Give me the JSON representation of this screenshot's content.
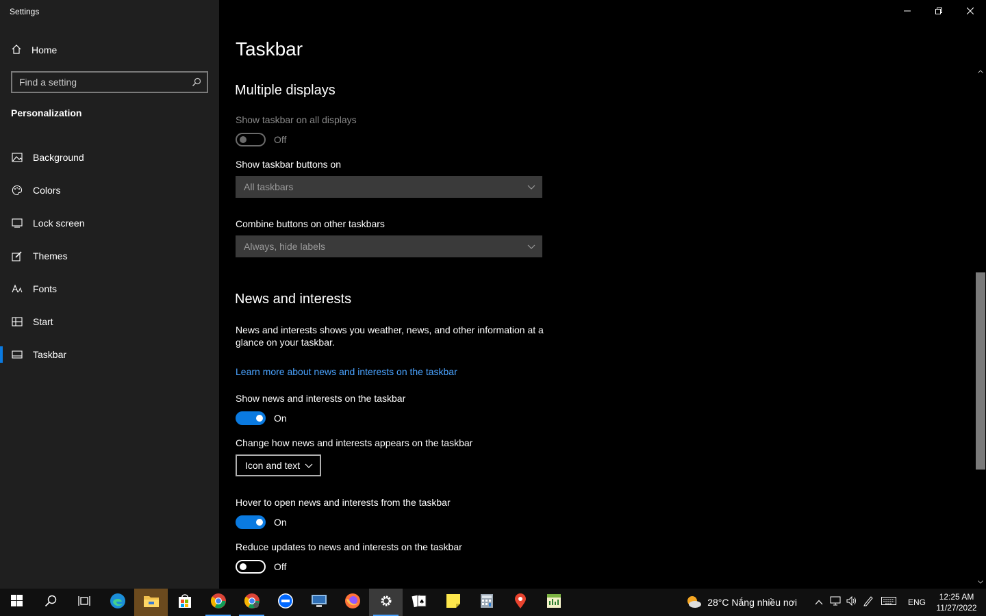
{
  "window": {
    "title": "Settings"
  },
  "sidebar": {
    "home_label": "Home",
    "search_placeholder": "Find a setting",
    "section": "Personalization",
    "items": [
      {
        "label": "Background",
        "icon": "picture-icon"
      },
      {
        "label": "Colors",
        "icon": "palette-icon"
      },
      {
        "label": "Lock screen",
        "icon": "lock-screen-icon"
      },
      {
        "label": "Themes",
        "icon": "brush-icon"
      },
      {
        "label": "Fonts",
        "icon": "font-icon"
      },
      {
        "label": "Start",
        "icon": "start-icon"
      },
      {
        "label": "Taskbar",
        "icon": "taskbar-icon",
        "active": true
      }
    ]
  },
  "main": {
    "title": "Taskbar",
    "multiple_displays": {
      "heading": "Multiple displays",
      "show_all_label": "Show taskbar on all displays",
      "show_all_state": "Off",
      "buttons_on_label": "Show taskbar buttons on",
      "buttons_on_value": "All taskbars",
      "combine_label": "Combine buttons on other taskbars",
      "combine_value": "Always, hide labels"
    },
    "news": {
      "heading": "News and interests",
      "description": "News and interests shows you weather, news, and other information at a glance on your taskbar.",
      "link": "Learn more about news and interests on the taskbar",
      "show_label": "Show news and interests on the taskbar",
      "show_state": "On",
      "appearance_label": "Change how news and interests appears on the taskbar",
      "appearance_value": "Icon and text",
      "hover_label": "Hover to open news and interests from the taskbar",
      "hover_state": "On",
      "reduce_label": "Reduce updates to news and interests on the taskbar",
      "reduce_state": "Off"
    }
  },
  "taskbar": {
    "weather": "28°C  Nắng nhiều nơi",
    "language": "ENG",
    "time": "12:25 AM",
    "date": "11/27/2022"
  },
  "colors": {
    "accent": "#0a7ae0",
    "sidebar_bg": "#1f1f1f",
    "main_bg": "#000000",
    "link": "#4aa3ff"
  }
}
